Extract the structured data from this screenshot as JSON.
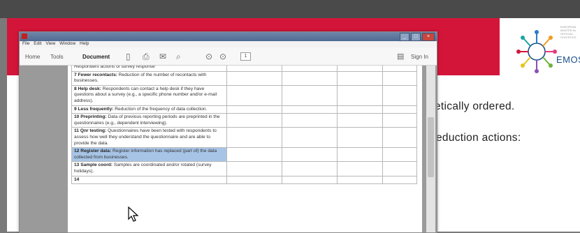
{
  "top_strip": {
    "text": ""
  },
  "slide": {
    "line1": "etically ordered.",
    "line2": "eduction actions:",
    "logo_text": "EMOS",
    "logo_small": "EUROPEAN MASTER IN OFFICIAL STATISTICS",
    "colors": {
      "band": "#d4153a",
      "logo_blue": "#1b4e8c"
    }
  },
  "window": {
    "title": "",
    "menu": [
      "File",
      "Edit",
      "View",
      "Window",
      "Help"
    ],
    "toolbar": {
      "home": "Home",
      "tools": "Tools",
      "document": "Document",
      "page": "1",
      "sign_in": "Sign In"
    }
  },
  "table_rows": [
    {
      "num": "",
      "title": "",
      "text": "Respondent actions of survey response",
      "highlight": false
    },
    {
      "num": "7",
      "title": "Fewer recontacts:",
      "text": "Reduction of the number of recontacts with businesses.",
      "highlight": false
    },
    {
      "num": "8",
      "title": "Help desk:",
      "text": "Respondents can contact a help desk if they have questions about a survey (e.g., a specific phone number and/or e-mail address).",
      "highlight": false
    },
    {
      "num": "9",
      "title": "Less frequently:",
      "text": "Reduction of the frequency of data collection.",
      "highlight": false
    },
    {
      "num": "10",
      "title": "Preprinting:",
      "text": "Data of previous reporting periods are preprinted in the questionnaires (e.g., dependent interviewing).",
      "highlight": false
    },
    {
      "num": "11",
      "title": "Qnr testing:",
      "text": "Questionnaires have been tested with respondents to assess how well they understand the questionnaire and are able to provide the data.",
      "highlight": false
    },
    {
      "num": "12",
      "title": "Register data:",
      "text": "Register information has replaced (part of) the data collected from businesses.",
      "highlight": true
    },
    {
      "num": "13",
      "title": "Sample coord:",
      "text": "Samples are coordinated and/or rotated (survey holidays).",
      "highlight": false
    },
    {
      "num": "14",
      "title": "",
      "text": "",
      "highlight": false
    }
  ]
}
